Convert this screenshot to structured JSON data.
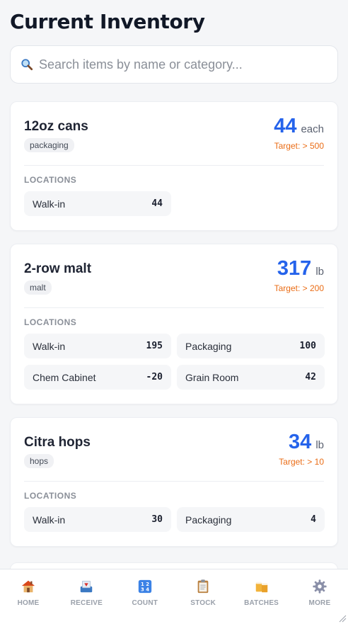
{
  "page": {
    "title": "Current Inventory"
  },
  "search": {
    "placeholder": "Search items by name or category..."
  },
  "sections": {
    "locations_heading": "LOCATIONS"
  },
  "items": [
    {
      "name": "12oz cans",
      "category": "packaging",
      "quantity": "44",
      "unit": "each",
      "target": "Target: > 500",
      "locations": [
        {
          "name": "Walk-in",
          "count": "44"
        }
      ]
    },
    {
      "name": "2-row malt",
      "category": "malt",
      "quantity": "317",
      "unit": "lb",
      "target": "Target: > 200",
      "locations": [
        {
          "name": "Walk-in",
          "count": "195"
        },
        {
          "name": "Packaging",
          "count": "100"
        },
        {
          "name": "Chem Cabinet",
          "count": "-20"
        },
        {
          "name": "Grain Room",
          "count": "42"
        }
      ]
    },
    {
      "name": "Citra hops",
      "category": "hops",
      "quantity": "34",
      "unit": "lb",
      "target": "Target: > 10",
      "locations": [
        {
          "name": "Walk-in",
          "count": "30"
        },
        {
          "name": "Packaging",
          "count": "4"
        }
      ]
    }
  ],
  "nav": {
    "tabs": [
      {
        "label": "HOME",
        "icon": "house-icon"
      },
      {
        "label": "RECEIVE",
        "icon": "inbox-tray-icon"
      },
      {
        "label": "COUNT",
        "icon": "numbers-icon"
      },
      {
        "label": "STOCK",
        "icon": "clipboard-icon"
      },
      {
        "label": "BATCHES",
        "icon": "beer-mugs-icon"
      },
      {
        "label": "MORE",
        "icon": "gear-icon"
      }
    ]
  },
  "colors": {
    "accent": "#2563eb",
    "warning": "#ea6c15",
    "background": "#f5f6f8"
  }
}
